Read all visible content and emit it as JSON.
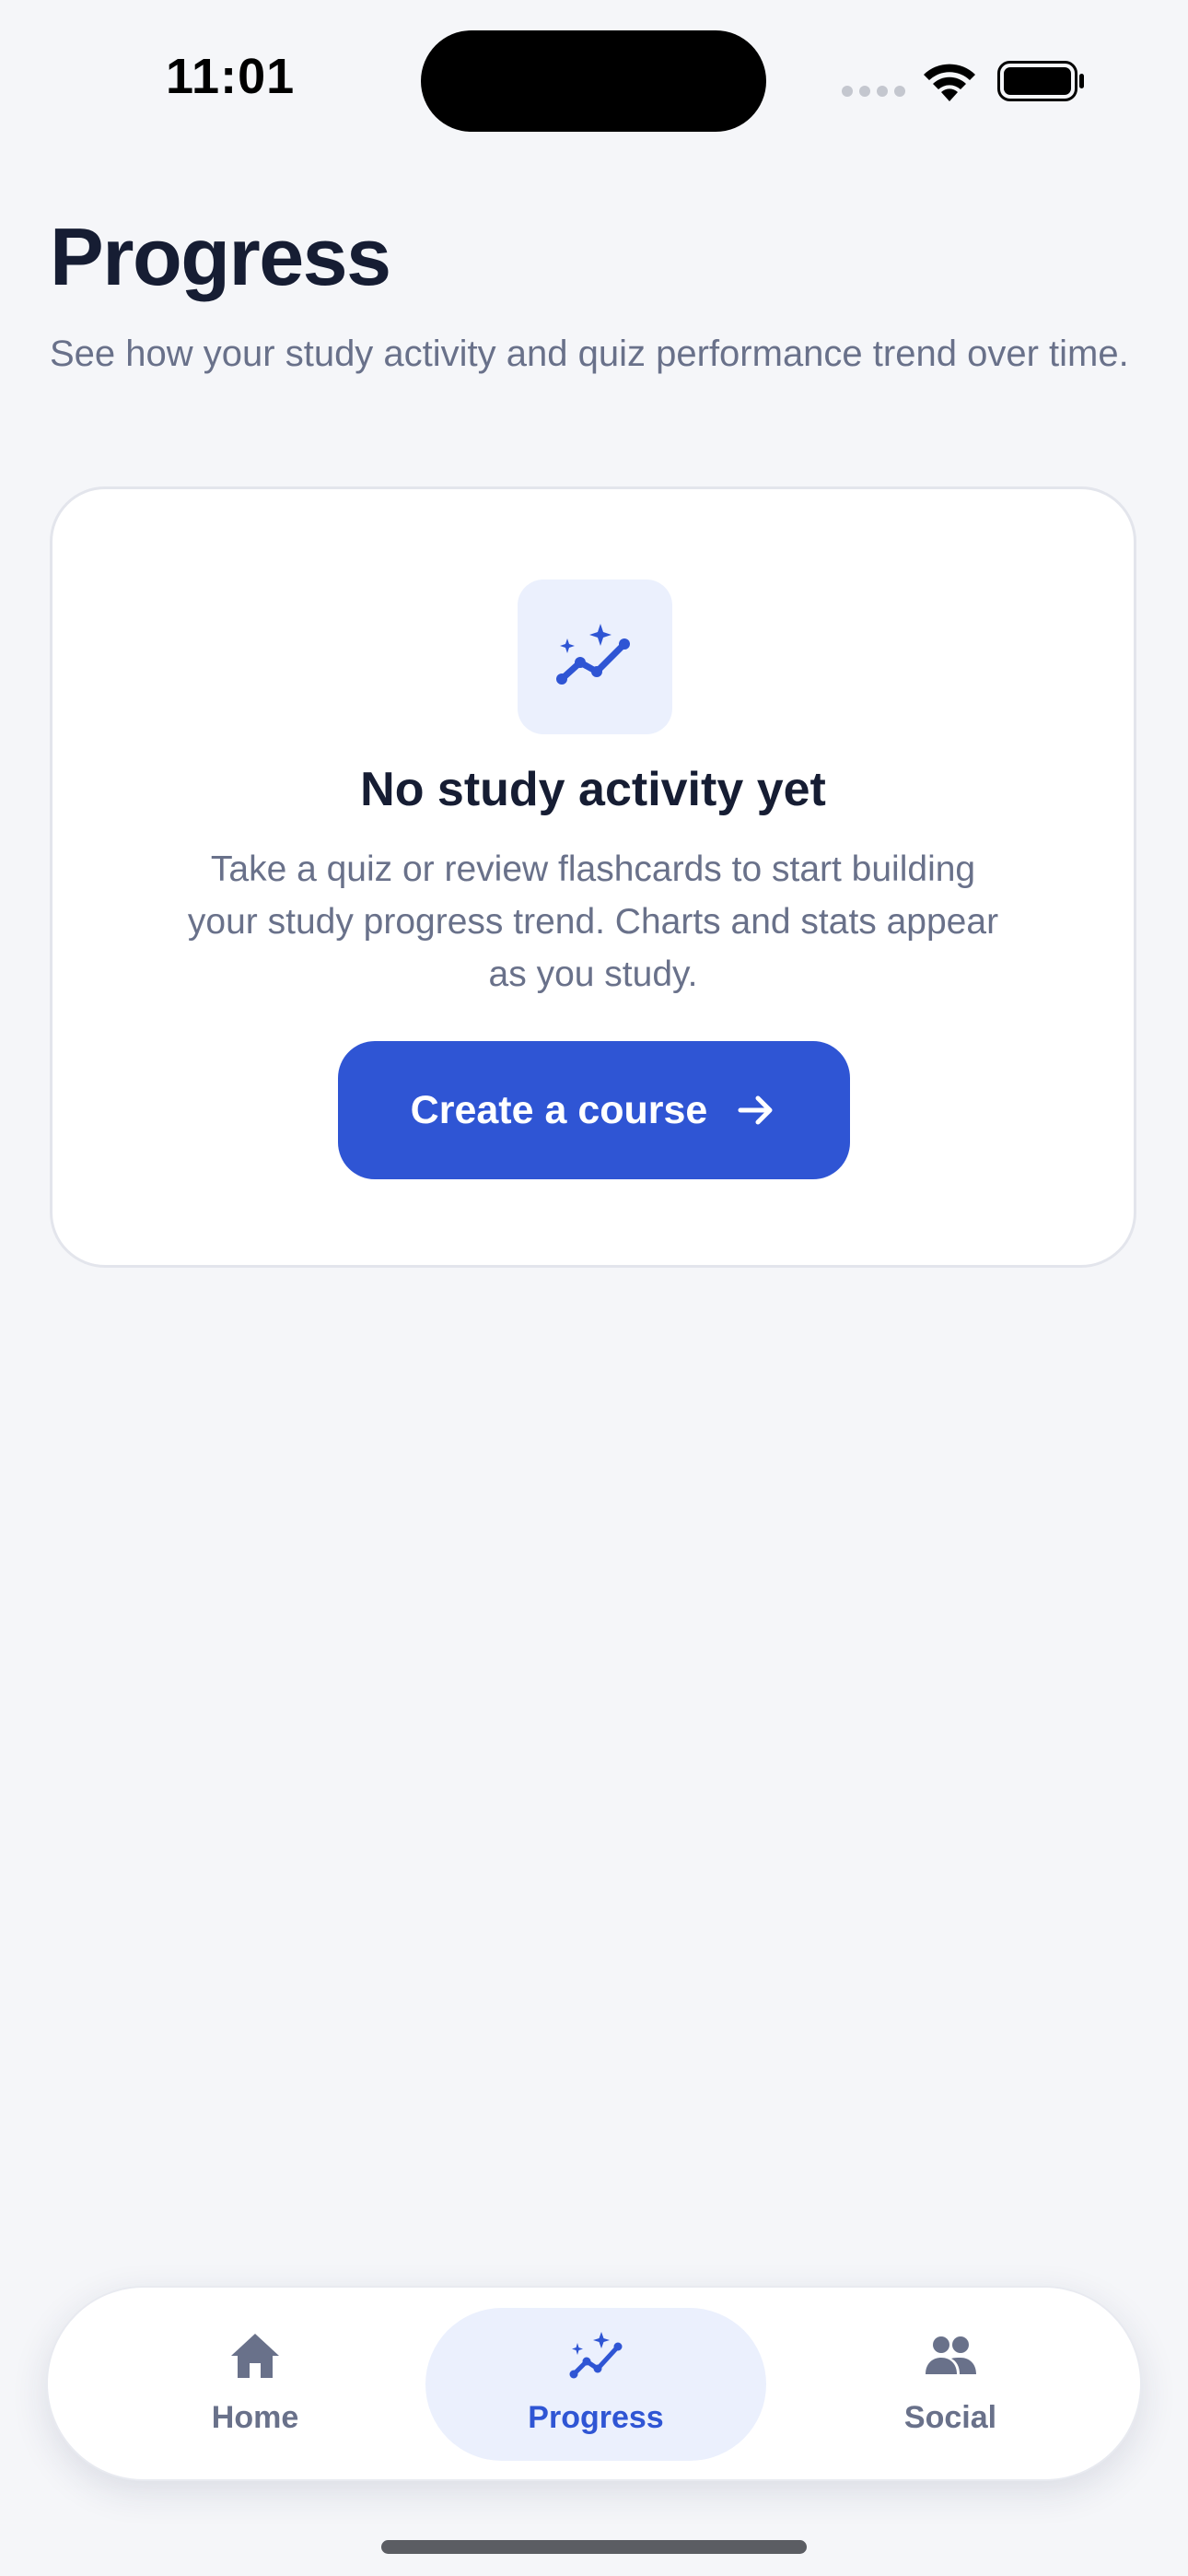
{
  "status_bar": {
    "time": "11:01"
  },
  "header": {
    "title": "Progress",
    "subtitle": "See how your study activity and quiz performance trend over time."
  },
  "empty_state": {
    "icon": "trend-sparkle-icon",
    "title": "No study activity yet",
    "body": "Take a quiz or review flashcards to start building your study progress trend. Charts and stats appear as you study.",
    "cta_label": "Create a course",
    "cta_icon": "arrow-right-icon"
  },
  "tab_bar": {
    "active_tab": "Progress",
    "items": [
      {
        "label": "Home",
        "icon": "home-icon"
      },
      {
        "label": "Progress",
        "icon": "trend-sparkle-icon"
      },
      {
        "label": "Social",
        "icon": "people-icon"
      }
    ]
  },
  "colors": {
    "background": "#f5f6f9",
    "accent": "#2f55d4",
    "accent_soft": "#ebf0fd",
    "text_primary": "#161d33",
    "text_secondary": "#69718a"
  }
}
